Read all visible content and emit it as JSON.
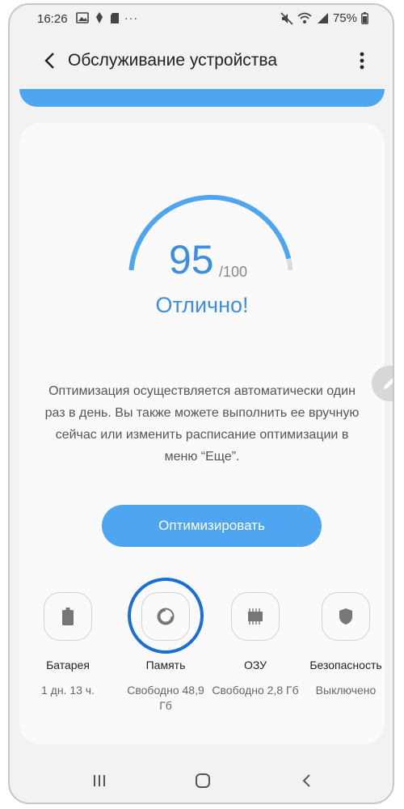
{
  "status_bar": {
    "time": "16:26",
    "dots": "···",
    "battery_percent": "75%"
  },
  "app_bar": {
    "title": "Обслуживание устройства"
  },
  "score": {
    "value": "95",
    "max": "/100",
    "status": "Отлично!",
    "level": 0.95
  },
  "description": "Оптимизация осуществляется автоматически один раз в день. Вы также можете выполнить ее вручную сейчас или изменить расписание оптимизации в меню “Еще”.",
  "optimize_button": "Оптимизировать",
  "features": [
    {
      "label": "Батарея",
      "value": "1 дн. 13 ч.",
      "icon": "battery-icon"
    },
    {
      "label": "Память",
      "value": "Свободно 48,9 Гб",
      "icon": "storage-pie-icon"
    },
    {
      "label": "ОЗУ",
      "value": "Свободно 2,8 Гб",
      "icon": "memory-chip-icon"
    },
    {
      "label": "Безопасность",
      "value": "Выключено",
      "icon": "shield-icon"
    }
  ],
  "colors": {
    "accent": "#4ea6f1",
    "score_text": "#3d8de0",
    "highlight": "#1a6fd6"
  }
}
